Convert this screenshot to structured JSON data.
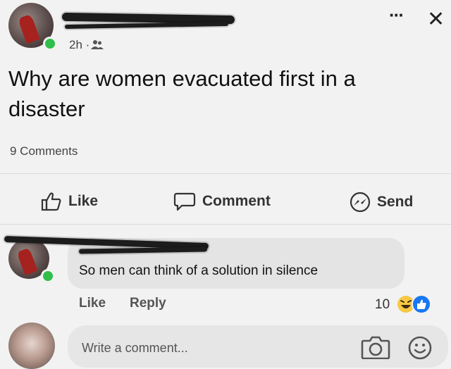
{
  "post": {
    "time": "2h · ",
    "text_line1": "Why are women evacuated first in a",
    "text_line2": "disaster",
    "comments_count": "9 Comments"
  },
  "header_actions": {
    "more_label": "···",
    "close_label": "✕"
  },
  "actions": {
    "like": "Like",
    "comment": "Comment",
    "send": "Send"
  },
  "comment": {
    "text": "So men can think of a solution in silence",
    "like": "Like",
    "reply": "Reply",
    "reaction_count": "10"
  },
  "composer": {
    "placeholder": "Write a comment..."
  },
  "colors": {
    "background": "#f2f2f2",
    "online": "#2fbf4a",
    "like_reaction": "#1877f2",
    "haha_reaction": "#f7c845"
  },
  "icons": [
    "audience-friends-icon",
    "thumbs-up-icon",
    "comment-icon",
    "messenger-icon",
    "camera-icon",
    "emoji-icon"
  ]
}
